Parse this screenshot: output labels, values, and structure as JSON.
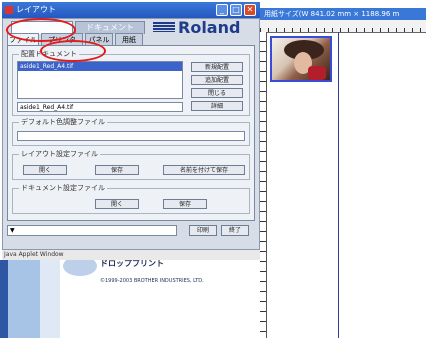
{
  "window": {
    "title": "レイアウト",
    "controls": {
      "minimize": "_",
      "maximize": "□",
      "close": "✕"
    }
  },
  "tabs": [
    {
      "label": "レイアウト",
      "active": true
    },
    {
      "label": "ドキュメント",
      "active": false
    }
  ],
  "logo": "Roland",
  "subtabs": [
    {
      "label": "ファイル",
      "active": true
    },
    {
      "label": "プリンタ",
      "active": false
    },
    {
      "label": "パネル",
      "active": false
    },
    {
      "label": "用紙",
      "active": false
    }
  ],
  "placed_docs": {
    "legend": "配置ドキュメント",
    "items": [
      "aside1_Red_A4.tif"
    ],
    "field_value": "aside1_Red_A4.tif",
    "buttons": {
      "new": "新規配置",
      "add": "追加配置",
      "close": "閉じる",
      "detail": "詳細"
    }
  },
  "default_color": {
    "legend": "デフォルト色調整ファイル"
  },
  "layout_settings": {
    "legend": "レイアウト設定ファイル",
    "buttons": {
      "open": "開く",
      "save": "保存",
      "save_as": "名前を付けて保存"
    }
  },
  "doc_settings": {
    "legend": "ドキュメント設定ファイル",
    "buttons": {
      "open": "開く",
      "save": "保存"
    }
  },
  "bottom_bar": {
    "dropdown_arrow": "▼",
    "print": "印刷",
    "exit": "終了"
  },
  "statusbar": "Java Applet Window",
  "doc_window": {
    "title": "用紙サイズ(W 841.02 mm × 1188.96 m"
  },
  "background_app": {
    "product": "ドロップブリント",
    "copyright": "©1999-2003 BROTHER INDUSTRIES, LTD."
  },
  "colors": {
    "accent": "#3a78d8",
    "highlight": "#e11b1b",
    "selection": "#3b63c9"
  }
}
